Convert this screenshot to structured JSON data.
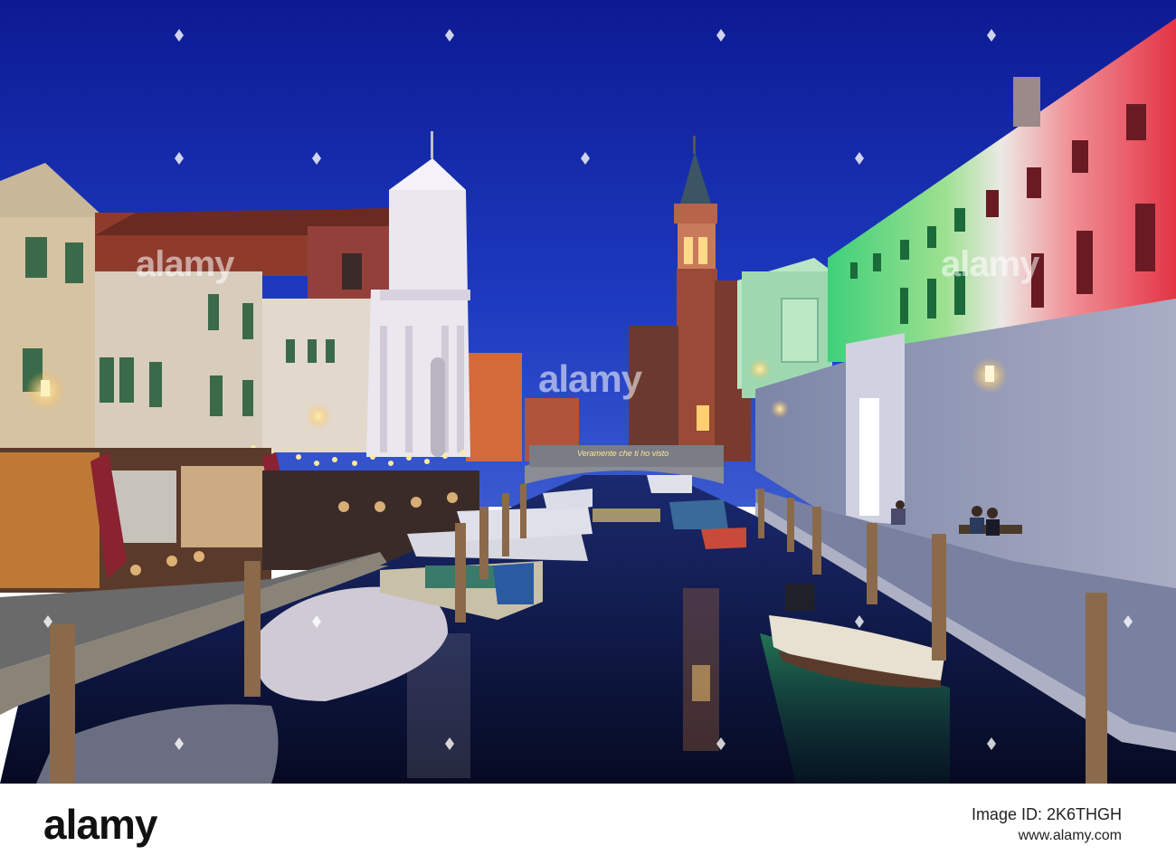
{
  "photo": {
    "alt": "Canal at dusk with restaurants, moored boats, a church facade, bell tower and a building lit in green, white and red",
    "bridge_sign": "Veramente che ti ho visto",
    "watermark": {
      "center": "alamy",
      "left": "alamy",
      "right": "alamy"
    }
  },
  "footer": {
    "logo": "alamy",
    "image_id": "Image ID: 2K6THGH",
    "site": "www.alamy.com"
  },
  "colors": {
    "sky_top": "#0f1f9a",
    "sky_bottom": "#3050c8",
    "italian_green": "#3fd07a",
    "italian_white": "#f0f0f0",
    "italian_red": "#e83a4a",
    "lamp_glow": "#ffd77a"
  }
}
